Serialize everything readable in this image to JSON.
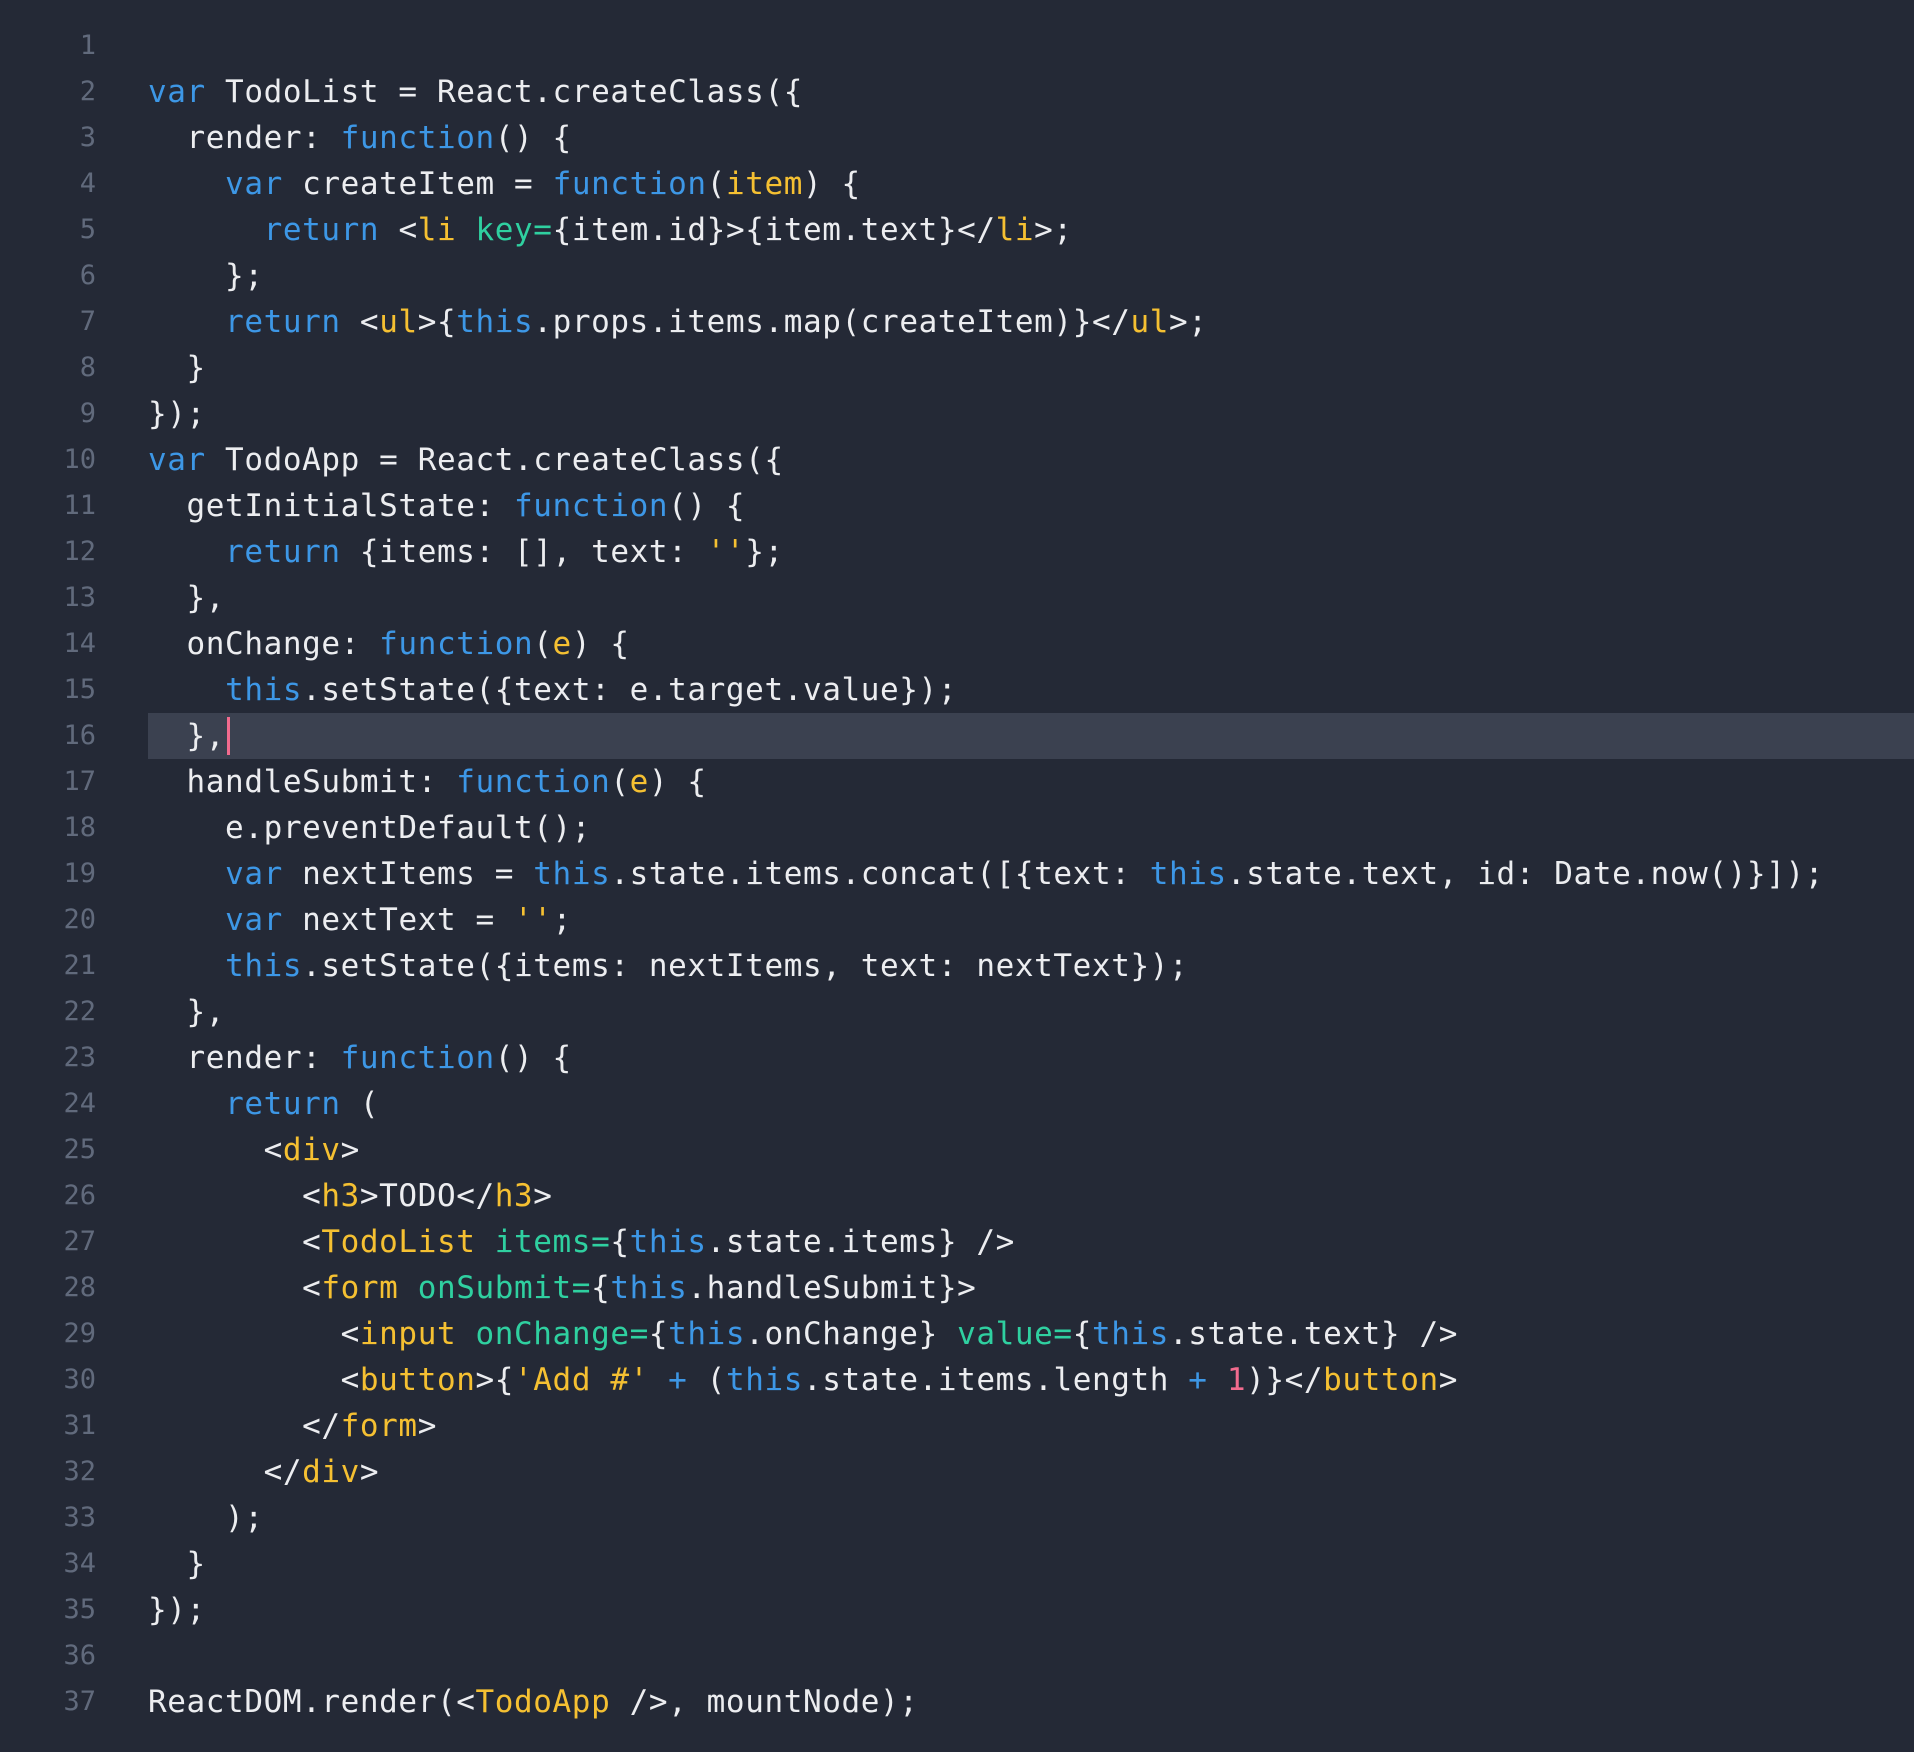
{
  "colors": {
    "background": "#242936",
    "active_line": "#3b4150",
    "gutter": "#616a7c",
    "plain": "#ecedf0",
    "keyword": "#3d97e6",
    "tag": "#f5c032",
    "param": "#f5c032",
    "string": "#f5c032",
    "attr": "#2fd0a0",
    "operator": "#3d97e6",
    "number": "#f26b8e",
    "cursor": "#f26b8e"
  },
  "editor": {
    "active_line": 16,
    "lines": [
      {
        "n": "1",
        "tokens": []
      },
      {
        "n": "2",
        "tokens": [
          [
            "keyword",
            "var"
          ],
          [
            "plain",
            " TodoList = React.createClass({"
          ]
        ]
      },
      {
        "n": "3",
        "tokens": [
          [
            "plain",
            "  render: "
          ],
          [
            "keyword",
            "function"
          ],
          [
            "plain",
            "() {"
          ]
        ]
      },
      {
        "n": "4",
        "tokens": [
          [
            "plain",
            "    "
          ],
          [
            "keyword",
            "var"
          ],
          [
            "plain",
            " createItem = "
          ],
          [
            "keyword",
            "function"
          ],
          [
            "plain",
            "("
          ],
          [
            "param",
            "item"
          ],
          [
            "plain",
            ") {"
          ]
        ]
      },
      {
        "n": "5",
        "tokens": [
          [
            "plain",
            "      "
          ],
          [
            "keyword",
            "return"
          ],
          [
            "plain",
            " <"
          ],
          [
            "tag",
            "li"
          ],
          [
            "plain",
            " "
          ],
          [
            "attr",
            "key="
          ],
          [
            "plain",
            "{item.id}>{item.text}</"
          ],
          [
            "tag",
            "li"
          ],
          [
            "plain",
            ">;"
          ]
        ]
      },
      {
        "n": "6",
        "tokens": [
          [
            "plain",
            "    };"
          ]
        ]
      },
      {
        "n": "7",
        "tokens": [
          [
            "plain",
            "    "
          ],
          [
            "keyword",
            "return"
          ],
          [
            "plain",
            " <"
          ],
          [
            "tag",
            "ul"
          ],
          [
            "plain",
            ">{"
          ],
          [
            "keyword",
            "this"
          ],
          [
            "plain",
            ".props.items.map(createItem)}</"
          ],
          [
            "tag",
            "ul"
          ],
          [
            "plain",
            ">;"
          ]
        ]
      },
      {
        "n": "8",
        "tokens": [
          [
            "plain",
            "  }"
          ]
        ]
      },
      {
        "n": "9",
        "tokens": [
          [
            "plain",
            "});"
          ]
        ]
      },
      {
        "n": "10",
        "tokens": [
          [
            "keyword",
            "var"
          ],
          [
            "plain",
            " TodoApp = React.createClass({"
          ]
        ]
      },
      {
        "n": "11",
        "tokens": [
          [
            "plain",
            "  getInitialState: "
          ],
          [
            "keyword",
            "function"
          ],
          [
            "plain",
            "() {"
          ]
        ]
      },
      {
        "n": "12",
        "tokens": [
          [
            "plain",
            "    "
          ],
          [
            "keyword",
            "return"
          ],
          [
            "plain",
            " {items: [], text: "
          ],
          [
            "string",
            "''"
          ],
          [
            "plain",
            "};"
          ]
        ]
      },
      {
        "n": "13",
        "tokens": [
          [
            "plain",
            "  },"
          ]
        ]
      },
      {
        "n": "14",
        "tokens": [
          [
            "plain",
            "  onChange: "
          ],
          [
            "keyword",
            "function"
          ],
          [
            "plain",
            "("
          ],
          [
            "param",
            "e"
          ],
          [
            "plain",
            ") {"
          ]
        ]
      },
      {
        "n": "15",
        "tokens": [
          [
            "plain",
            "    "
          ],
          [
            "keyword",
            "this"
          ],
          [
            "plain",
            ".setState({text: e.target.value});"
          ]
        ]
      },
      {
        "n": "16",
        "tokens": [
          [
            "plain",
            "  },"
          ]
        ],
        "cursor": true
      },
      {
        "n": "17",
        "tokens": [
          [
            "plain",
            "  handleSubmit: "
          ],
          [
            "keyword",
            "function"
          ],
          [
            "plain",
            "("
          ],
          [
            "param",
            "e"
          ],
          [
            "plain",
            ") {"
          ]
        ]
      },
      {
        "n": "18",
        "tokens": [
          [
            "plain",
            "    e.preventDefault();"
          ]
        ]
      },
      {
        "n": "19",
        "tokens": [
          [
            "plain",
            "    "
          ],
          [
            "keyword",
            "var"
          ],
          [
            "plain",
            " nextItems = "
          ],
          [
            "keyword",
            "this"
          ],
          [
            "plain",
            ".state.items.concat([{text: "
          ],
          [
            "keyword",
            "this"
          ],
          [
            "plain",
            ".state.text, id: Date.now()}]);"
          ]
        ]
      },
      {
        "n": "20",
        "tokens": [
          [
            "plain",
            "    "
          ],
          [
            "keyword",
            "var"
          ],
          [
            "plain",
            " nextText = "
          ],
          [
            "string",
            "''"
          ],
          [
            "plain",
            ";"
          ]
        ]
      },
      {
        "n": "21",
        "tokens": [
          [
            "plain",
            "    "
          ],
          [
            "keyword",
            "this"
          ],
          [
            "plain",
            ".setState({items: nextItems, text: nextText});"
          ]
        ]
      },
      {
        "n": "22",
        "tokens": [
          [
            "plain",
            "  },"
          ]
        ]
      },
      {
        "n": "23",
        "tokens": [
          [
            "plain",
            "  render: "
          ],
          [
            "keyword",
            "function"
          ],
          [
            "plain",
            "() {"
          ]
        ]
      },
      {
        "n": "24",
        "tokens": [
          [
            "plain",
            "    "
          ],
          [
            "keyword",
            "return"
          ],
          [
            "plain",
            " ("
          ]
        ]
      },
      {
        "n": "25",
        "tokens": [
          [
            "plain",
            "      <"
          ],
          [
            "tag",
            "div"
          ],
          [
            "plain",
            ">"
          ]
        ]
      },
      {
        "n": "26",
        "tokens": [
          [
            "plain",
            "        <"
          ],
          [
            "tag",
            "h3"
          ],
          [
            "plain",
            ">TODO</"
          ],
          [
            "tag",
            "h3"
          ],
          [
            "plain",
            ">"
          ]
        ]
      },
      {
        "n": "27",
        "tokens": [
          [
            "plain",
            "        <"
          ],
          [
            "tag",
            "TodoList"
          ],
          [
            "plain",
            " "
          ],
          [
            "attr",
            "items="
          ],
          [
            "plain",
            "{"
          ],
          [
            "keyword",
            "this"
          ],
          [
            "plain",
            ".state.items} />"
          ]
        ]
      },
      {
        "n": "28",
        "tokens": [
          [
            "plain",
            "        <"
          ],
          [
            "tag",
            "form"
          ],
          [
            "plain",
            " "
          ],
          [
            "attr",
            "onSubmit="
          ],
          [
            "plain",
            "{"
          ],
          [
            "keyword",
            "this"
          ],
          [
            "plain",
            ".handleSubmit}>"
          ]
        ]
      },
      {
        "n": "29",
        "tokens": [
          [
            "plain",
            "          <"
          ],
          [
            "tag",
            "input"
          ],
          [
            "plain",
            " "
          ],
          [
            "attr",
            "onChange="
          ],
          [
            "plain",
            "{"
          ],
          [
            "keyword",
            "this"
          ],
          [
            "plain",
            ".onChange} "
          ],
          [
            "attr",
            "value="
          ],
          [
            "plain",
            "{"
          ],
          [
            "keyword",
            "this"
          ],
          [
            "plain",
            ".state.text} />"
          ]
        ]
      },
      {
        "n": "30",
        "tokens": [
          [
            "plain",
            "          <"
          ],
          [
            "tag",
            "button"
          ],
          [
            "plain",
            ">{"
          ],
          [
            "string",
            "'Add #'"
          ],
          [
            "plain",
            " "
          ],
          [
            "operator",
            "+"
          ],
          [
            "plain",
            " ("
          ],
          [
            "keyword",
            "this"
          ],
          [
            "plain",
            ".state.items.length "
          ],
          [
            "operator",
            "+"
          ],
          [
            "plain",
            " "
          ],
          [
            "number",
            "1"
          ],
          [
            "plain",
            ")}</"
          ],
          [
            "tag",
            "button"
          ],
          [
            "plain",
            ">"
          ]
        ]
      },
      {
        "n": "31",
        "tokens": [
          [
            "plain",
            "        </"
          ],
          [
            "tag",
            "form"
          ],
          [
            "plain",
            ">"
          ]
        ]
      },
      {
        "n": "32",
        "tokens": [
          [
            "plain",
            "      </"
          ],
          [
            "tag",
            "div"
          ],
          [
            "plain",
            ">"
          ]
        ]
      },
      {
        "n": "33",
        "tokens": [
          [
            "plain",
            "    );"
          ]
        ]
      },
      {
        "n": "34",
        "tokens": [
          [
            "plain",
            "  }"
          ]
        ]
      },
      {
        "n": "35",
        "tokens": [
          [
            "plain",
            "});"
          ]
        ]
      },
      {
        "n": "36",
        "tokens": []
      },
      {
        "n": "37",
        "tokens": [
          [
            "plain",
            "ReactDOM.render(<"
          ],
          [
            "tag",
            "TodoApp"
          ],
          [
            "plain",
            " />, mountNode);"
          ]
        ]
      }
    ]
  }
}
